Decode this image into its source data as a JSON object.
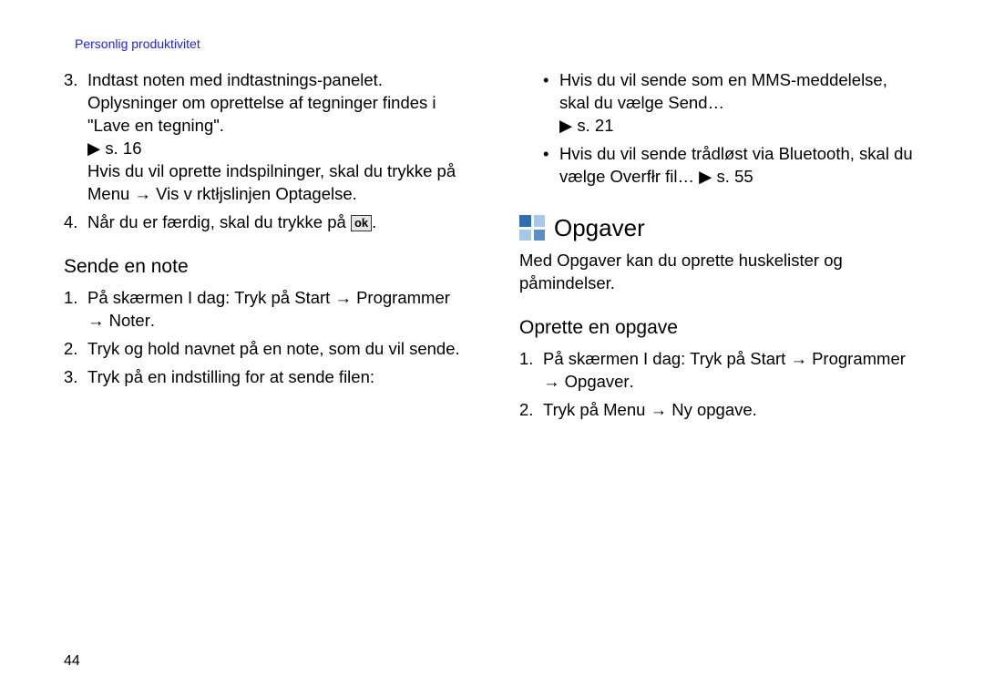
{
  "header": "Personlig produktivitet",
  "left": {
    "n3": {
      "a": "Indtast noten med indtastnings-panelet.",
      "b1": "Oplysninger om oprettelse af tegninger findes i \"Lave en tegning\".",
      "b2_pre": "▶",
      "b2_page": " s. 16",
      "c1": "Hvis du vil oprette indspilninger, skal du trykke på ",
      "c2": "Menu",
      "c3": " → ",
      "c4": "Vis v rktłjslinjen Optagelse",
      "c5": "."
    },
    "n4": {
      "a": "Når du er færdig, skal du trykke på ",
      "ok": "ok",
      "b": "."
    },
    "sub": "Sende en note",
    "s1": {
      "a": "På skærmen I dag: Tryk på ",
      "b": "Start",
      "c": " → ",
      "d": "Programmer",
      "e": " → ",
      "f": "Noter",
      "g": "."
    },
    "s2": "Tryk og hold navnet på en note, som du vil sende.",
    "s3": "Tryk på en indstilling for at sende filen:"
  },
  "right": {
    "b1": {
      "a": "Hvis du vil sende som en MMS-meddelelse, skal du vælge ",
      "b": "Send…",
      "c": "▶",
      "d": " s. 21"
    },
    "b2": {
      "a": "Hvis du vil sende trådløst via Bluetooth, skal du vælge ",
      "b": "Overfłr fil…",
      "c": " ▶",
      "d": " s. 55"
    },
    "section": "Opgaver",
    "intro": "Med Opgaver kan du oprette huskelister og påmindelser.",
    "sub": "Oprette en opgave",
    "o1": {
      "a": "På skærmen I dag: Tryk på ",
      "b": "Start",
      "c": " → ",
      "d": "Programmer",
      "e": " → ",
      "f": "Opgaver",
      "g": "."
    },
    "o2": {
      "a": "Tryk på ",
      "b": "Menu",
      "c": " → ",
      "d": "Ny opgave",
      "e": "."
    }
  },
  "pageNumber": "44"
}
